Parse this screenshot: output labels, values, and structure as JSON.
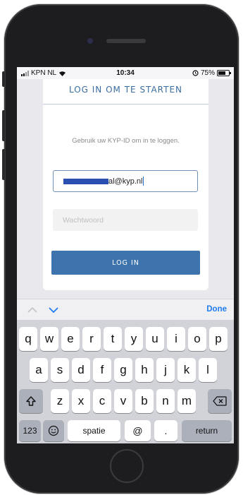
{
  "status_bar": {
    "carrier": "KPN NL",
    "time": "10:34",
    "battery": "75%"
  },
  "login_card": {
    "title": "LOG IN OM TE STARTEN",
    "subtitle": "Gebruik uw KYP-ID om in te loggen.",
    "email_value": "al@kyp.nl",
    "password_placeholder": "Wachtwoord",
    "login_button": "LOG IN"
  },
  "accessory_bar": {
    "done_label": "Done"
  },
  "keyboard": {
    "row1": [
      "q",
      "w",
      "e",
      "r",
      "t",
      "y",
      "u",
      "i",
      "o",
      "p"
    ],
    "row2": [
      "a",
      "s",
      "d",
      "f",
      "g",
      "h",
      "j",
      "k",
      "l"
    ],
    "row3": [
      "z",
      "x",
      "c",
      "v",
      "b",
      "n",
      "m"
    ],
    "numbers_key": "123",
    "space_key": "spatie",
    "at_key": "@",
    "dot_key": ".",
    "return_key": "return"
  },
  "colors": {
    "accent": "#3e74ad",
    "title": "#3a6ea0",
    "done": "#1f7cf2",
    "keyboard_bg": "#d1d3d9"
  },
  "icons": [
    "wifi-icon",
    "alarm-icon",
    "battery-icon",
    "chevron-up-icon",
    "chevron-down-icon",
    "shift-icon",
    "backspace-icon",
    "emoji-icon"
  ]
}
